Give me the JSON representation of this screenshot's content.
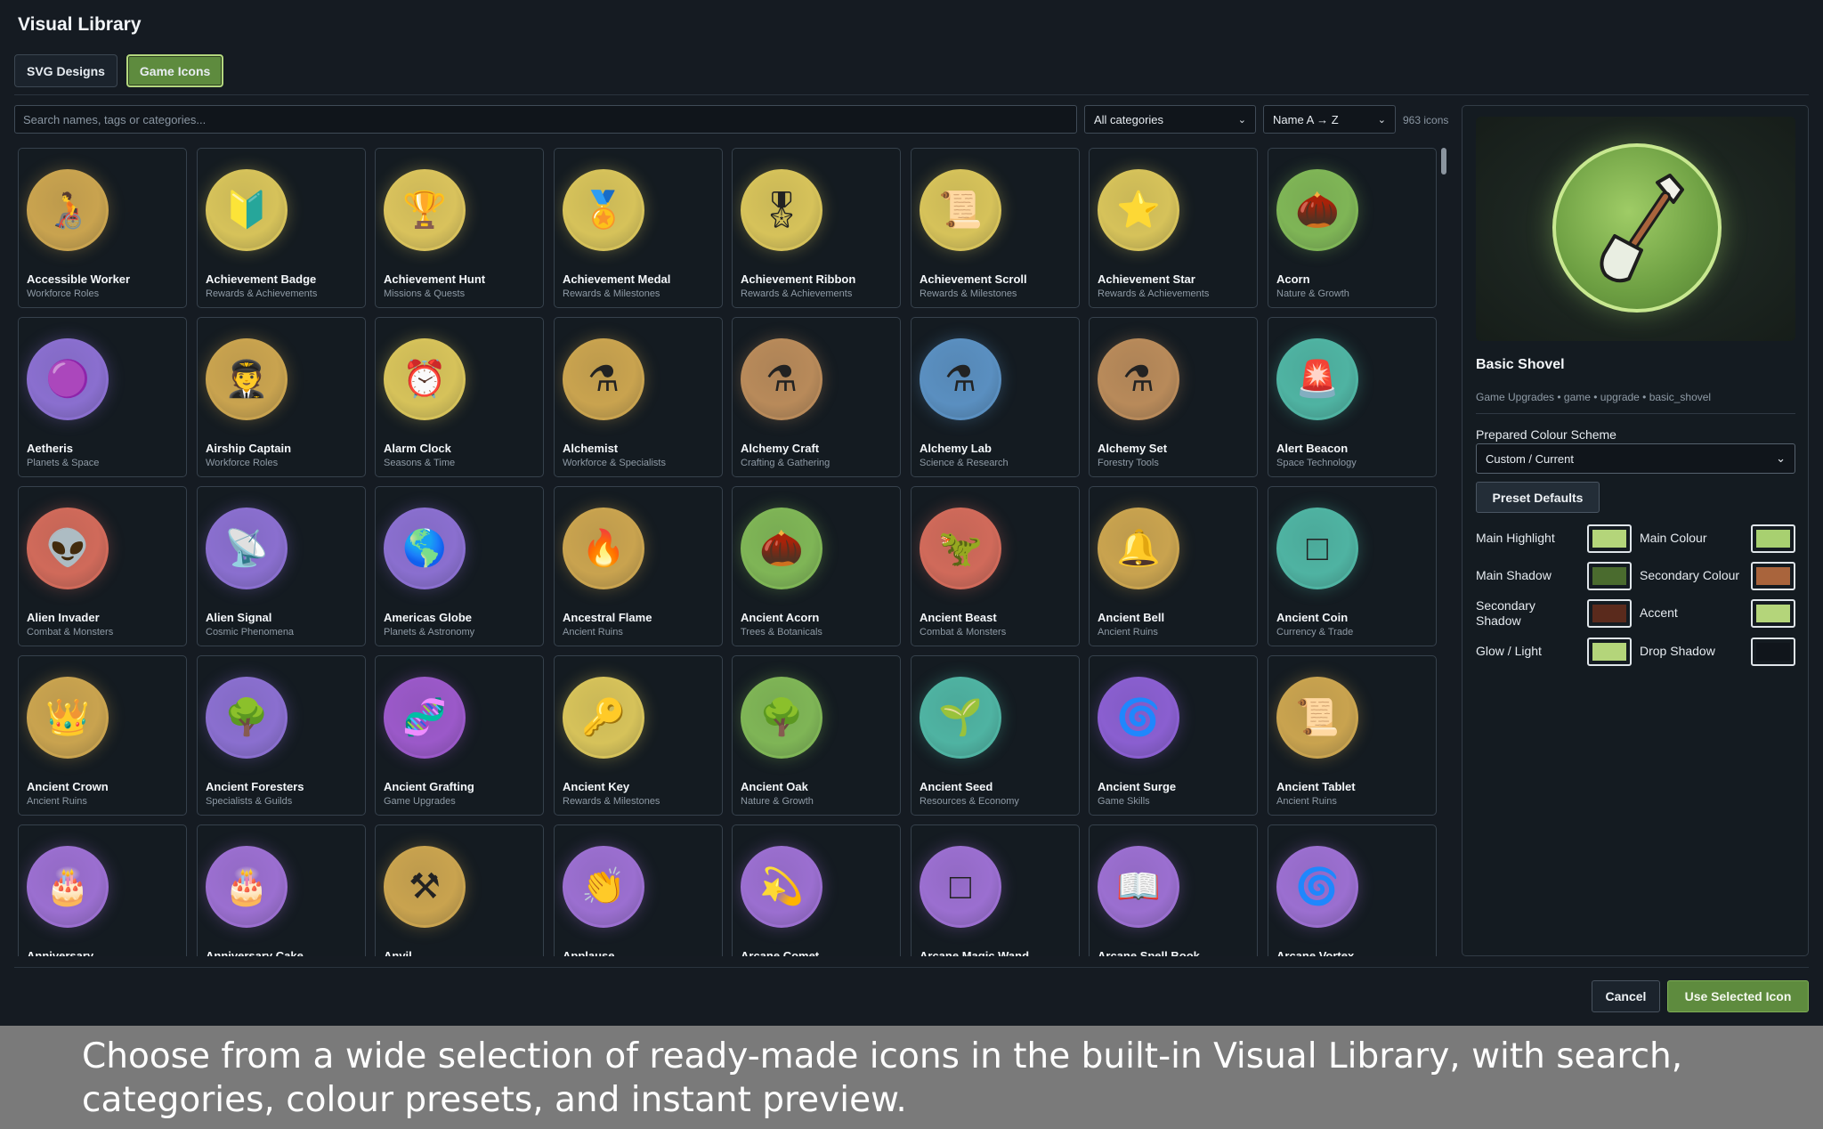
{
  "window": {
    "title": "Visual Library"
  },
  "tabs": [
    {
      "label": "SVG Designs",
      "active": false
    },
    {
      "label": "Game Icons",
      "active": true
    }
  ],
  "toolbar": {
    "search_placeholder": "Search names, tags or categories...",
    "category_select": "All categories",
    "sort_select": "Name A → Z",
    "count": "963 icons"
  },
  "icons": [
    {
      "name": "Accessible Worker",
      "category": "Workforce Roles",
      "glyph": "🧑‍🦽",
      "color": "#c9a34f"
    },
    {
      "name": "Achievement Badge",
      "category": "Rewards & Achievements",
      "glyph": "🔰",
      "color": "#d6c25a"
    },
    {
      "name": "Achievement Hunt",
      "category": "Missions & Quests",
      "glyph": "🏆",
      "color": "#d9c25c"
    },
    {
      "name": "Achievement Medal",
      "category": "Rewards & Milestones",
      "glyph": "🏅",
      "color": "#d6c25a"
    },
    {
      "name": "Achievement Ribbon",
      "category": "Rewards & Achievements",
      "glyph": "🎖",
      "color": "#d6c25a"
    },
    {
      "name": "Achievement Scroll",
      "category": "Rewards & Milestones",
      "glyph": "📜",
      "color": "#d6c25a"
    },
    {
      "name": "Achievement Star",
      "category": "Rewards & Achievements",
      "glyph": "⭐",
      "color": "#d6c25a"
    },
    {
      "name": "Acorn",
      "category": "Nature & Growth",
      "glyph": "🌰",
      "color": "#7fb556"
    },
    {
      "name": "Aetheris",
      "category": "Planets & Space",
      "glyph": "🟣",
      "color": "#8a6fcf"
    },
    {
      "name": "Airship Captain",
      "category": "Workforce Roles",
      "glyph": "🧑‍✈️",
      "color": "#c9a34f"
    },
    {
      "name": "Alarm Clock",
      "category": "Seasons & Time",
      "glyph": "⏰",
      "color": "#d6c25a"
    },
    {
      "name": "Alchemist",
      "category": "Workforce & Specialists",
      "glyph": "⚗",
      "color": "#c9a34f"
    },
    {
      "name": "Alchemy Craft",
      "category": "Crafting & Gathering",
      "glyph": "⚗",
      "color": "#b88a5a"
    },
    {
      "name": "Alchemy Lab",
      "category": "Science & Research",
      "glyph": "⚗",
      "color": "#5a8fc0"
    },
    {
      "name": "Alchemy Set",
      "category": "Forestry Tools",
      "glyph": "⚗",
      "color": "#b88a5a"
    },
    {
      "name": "Alert Beacon",
      "category": "Space Technology",
      "glyph": "🚨",
      "color": "#4fb3a2"
    },
    {
      "name": "Alien Invader",
      "category": "Combat & Monsters",
      "glyph": "👽",
      "color": "#d06a5a"
    },
    {
      "name": "Alien Signal",
      "category": "Cosmic Phenomena",
      "glyph": "📡",
      "color": "#8a6fcf"
    },
    {
      "name": "Americas Globe",
      "category": "Planets & Astronomy",
      "glyph": "🌎",
      "color": "#8a6fcf"
    },
    {
      "name": "Ancestral Flame",
      "category": "Ancient Ruins",
      "glyph": "🔥",
      "color": "#c9a34f"
    },
    {
      "name": "Ancient Acorn",
      "category": "Trees & Botanicals",
      "glyph": "🌰",
      "color": "#7fb556"
    },
    {
      "name": "Ancient Beast",
      "category": "Combat & Monsters",
      "glyph": "🦖",
      "color": "#d06a5a"
    },
    {
      "name": "Ancient Bell",
      "category": "Ancient Ruins",
      "glyph": "🔔",
      "color": "#c9a34f"
    },
    {
      "name": "Ancient Coin",
      "category": "Currency & Trade",
      "glyph": "□",
      "color": "#4fb3a2"
    },
    {
      "name": "Ancient Crown",
      "category": "Ancient Ruins",
      "glyph": "👑",
      "color": "#c9a34f"
    },
    {
      "name": "Ancient Foresters",
      "category": "Specialists & Guilds",
      "glyph": "🌳",
      "color": "#8a6fcf"
    },
    {
      "name": "Ancient Grafting",
      "category": "Game Upgrades",
      "glyph": "🧬",
      "color": "#9b59c9"
    },
    {
      "name": "Ancient Key",
      "category": "Rewards & Milestones",
      "glyph": "🔑",
      "color": "#d6c25a"
    },
    {
      "name": "Ancient Oak",
      "category": "Nature & Growth",
      "glyph": "🌳",
      "color": "#7fb556"
    },
    {
      "name": "Ancient Seed",
      "category": "Resources & Economy",
      "glyph": "🌱",
      "color": "#4fb3a2"
    },
    {
      "name": "Ancient Surge",
      "category": "Game Skills",
      "glyph": "🌀",
      "color": "#8a5fd0"
    },
    {
      "name": "Ancient Tablet",
      "category": "Ancient Ruins",
      "glyph": "📜",
      "color": "#c9a34f"
    },
    {
      "name": "Anniversary",
      "category": "",
      "glyph": "🎂",
      "color": "#9b6fd0"
    },
    {
      "name": "Anniversary Cake",
      "category": "",
      "glyph": "🎂",
      "color": "#9b6fd0"
    },
    {
      "name": "Anvil",
      "category": "",
      "glyph": "⚒",
      "color": "#c9a34f"
    },
    {
      "name": "Applause",
      "category": "",
      "glyph": "👏",
      "color": "#9b6fd0"
    },
    {
      "name": "Arcane Comet",
      "category": "",
      "glyph": "💫",
      "color": "#9b6fd0"
    },
    {
      "name": "Arcane Magic Wand",
      "category": "",
      "glyph": "□",
      "color": "#9b6fd0"
    },
    {
      "name": "Arcane Spell Book",
      "category": "",
      "glyph": "📖",
      "color": "#9b6fd0"
    },
    {
      "name": "Arcane Vortex",
      "category": "",
      "glyph": "🌀",
      "color": "#9b6fd0"
    }
  ],
  "selected": {
    "name": "Basic Shovel",
    "meta": "Game Upgrades • game • upgrade • basic_shovel",
    "scheme_label": "Prepared Colour Scheme",
    "scheme_value": "Custom / Current",
    "preset_button": "Preset Defaults",
    "colours": [
      {
        "label": "Main Highlight",
        "color": "#b4d57a"
      },
      {
        "label": "Main Colour",
        "color": "#a8d070"
      },
      {
        "label": "Main Shadow",
        "color": "#4a6b2e"
      },
      {
        "label": "Secondary Colour",
        "color": "#a9643c"
      },
      {
        "label": "Secondary Shadow",
        "color": "#5a2a1c"
      },
      {
        "label": "Accent",
        "color": "#b4d57a"
      },
      {
        "label": "Glow / Light",
        "color": "#b4d57a"
      },
      {
        "label": "Drop Shadow",
        "color": "#10151b"
      }
    ]
  },
  "footer": {
    "cancel": "Cancel",
    "use": "Use Selected Icon"
  },
  "caption": "Choose from a wide selection of ready-made icons in the built-in Visual Library, with search, categories, colour presets, and instant preview."
}
